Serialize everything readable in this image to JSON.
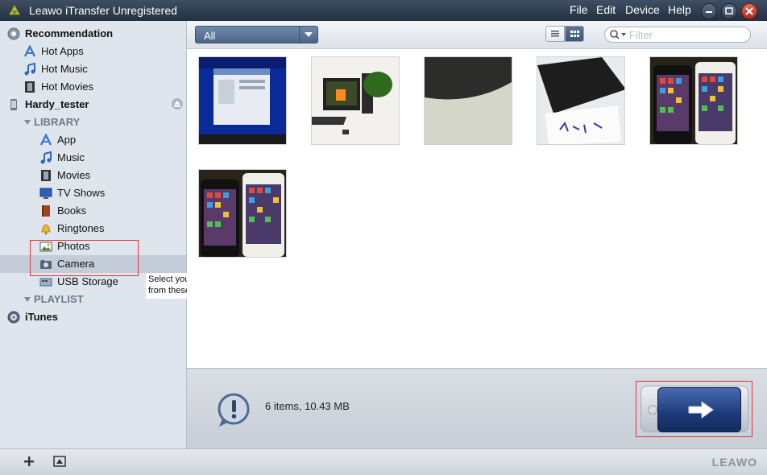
{
  "window": {
    "title": "Leawo iTransfer Unregistered",
    "menu": [
      "File",
      "Edit",
      "Device",
      "Help"
    ]
  },
  "sidebar": {
    "recommendation": {
      "label": "Recommendation",
      "items": [
        {
          "label": "Hot Apps",
          "icon": "app-store-icon"
        },
        {
          "label": "Hot Music",
          "icon": "music-note-icon"
        },
        {
          "label": "Hot Movies",
          "icon": "film-icon"
        }
      ]
    },
    "device": {
      "label": "Hardy_tester",
      "library": {
        "label": "LIBRARY",
        "items": [
          {
            "label": "App",
            "icon": "app-store-icon"
          },
          {
            "label": "Music",
            "icon": "music-note-icon"
          },
          {
            "label": "Movies",
            "icon": "film-icon"
          },
          {
            "label": "TV Shows",
            "icon": "tv-icon"
          },
          {
            "label": "Books",
            "icon": "book-icon"
          },
          {
            "label": "Ringtones",
            "icon": "bell-icon"
          },
          {
            "label": "Photos",
            "icon": "photo-icon"
          },
          {
            "label": "Camera",
            "icon": "camera-icon"
          },
          {
            "label": "USB Storage",
            "icon": "usb-storage-icon"
          }
        ]
      },
      "playlist": {
        "label": "PLAYLIST"
      }
    },
    "itunes": {
      "label": "iTunes"
    },
    "selected": "Camera"
  },
  "tooltip": {
    "line1": "Select your photos and images",
    "line2": "from these two options"
  },
  "toolbar": {
    "filter_value": "All",
    "search_placeholder": "Filter",
    "view_mode": "grid"
  },
  "status": {
    "summary": "6 items, 10.43 MB"
  },
  "footer": {
    "brand": "LEAWO"
  },
  "colors": {
    "highlight_border": "#e0333a",
    "accent": "#4c6687",
    "transfer_button": "#1c3a78"
  }
}
